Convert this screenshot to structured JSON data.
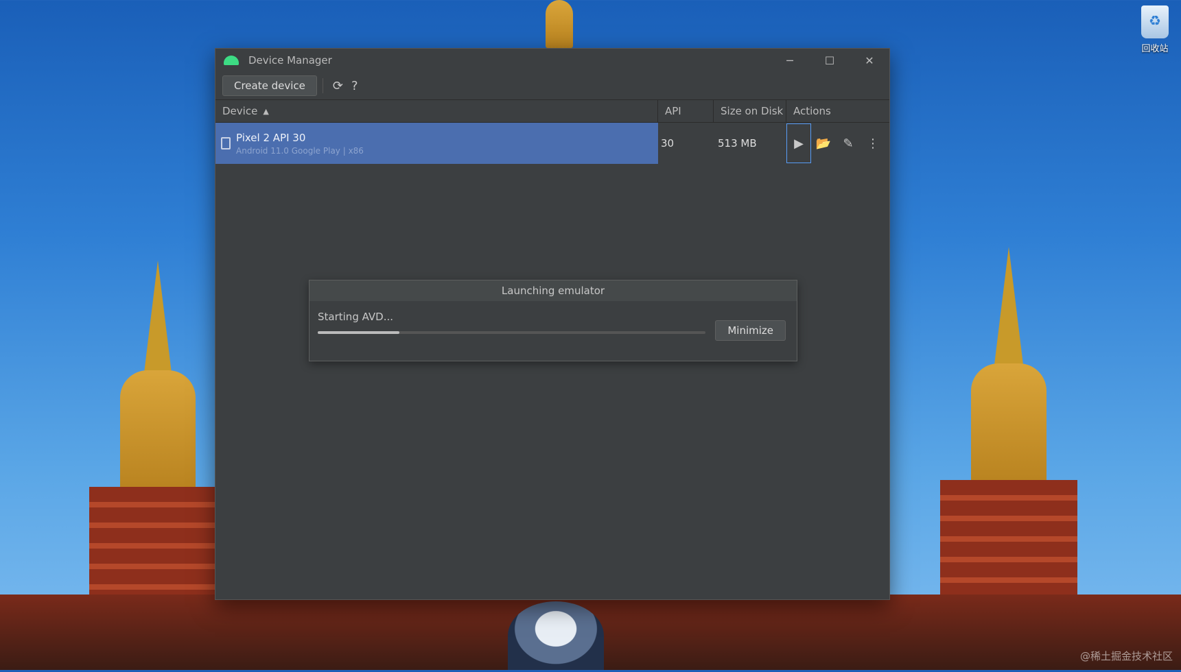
{
  "desktop": {
    "recycle_bin_label": "回收站",
    "watermark": "@稀土掘金技术社区"
  },
  "window": {
    "title": "Device Manager",
    "controls": {
      "minimize": "─",
      "maximize": "☐",
      "close": "✕"
    }
  },
  "toolbar": {
    "create_device_label": "Create device",
    "refresh_icon": "⟳",
    "help_icon": "?"
  },
  "table": {
    "headers": {
      "device": "Device",
      "sort_indicator": "▲",
      "api": "API",
      "size": "Size on Disk",
      "actions": "Actions"
    },
    "rows": [
      {
        "name": "Pixel 2 API 30",
        "subtitle": "Android 11.0 Google Play | x86",
        "api": "30",
        "size": "513 MB",
        "actions": {
          "play": "▶",
          "folder": "📂",
          "edit": "✎",
          "more": "⋮"
        }
      }
    ]
  },
  "dialog": {
    "title": "Launching emulator",
    "status": "Starting AVD...",
    "progress": 0.21,
    "minimize_label": "Minimize"
  }
}
